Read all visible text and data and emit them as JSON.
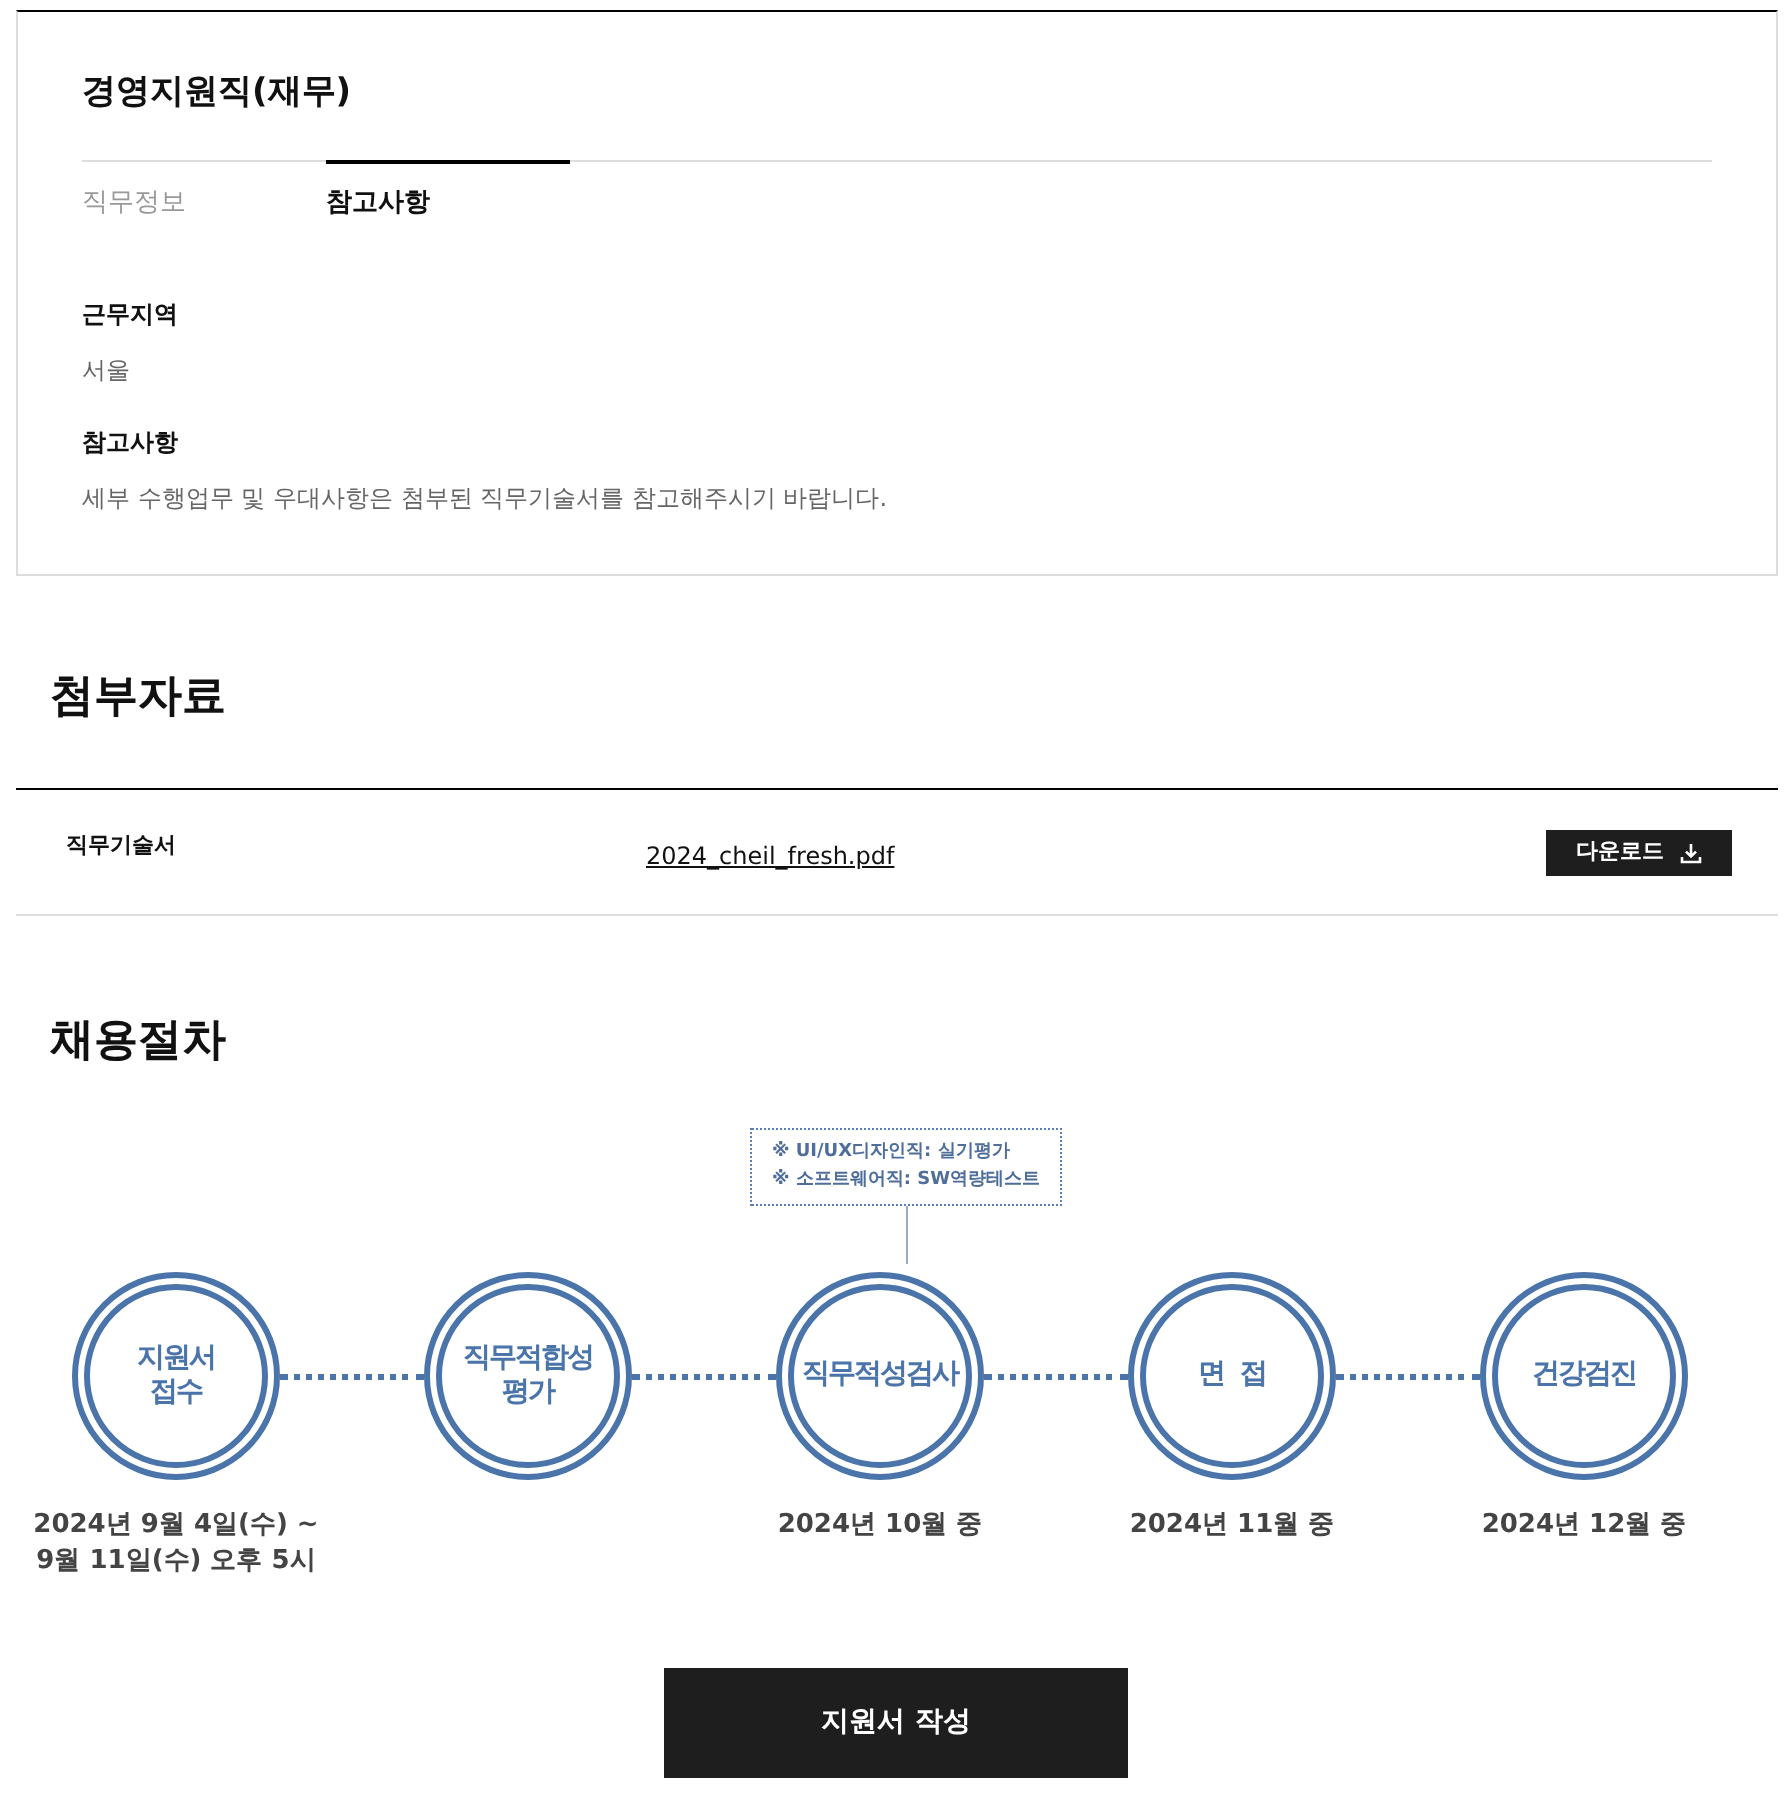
{
  "job": {
    "title": "경영지원직(재무)",
    "tabs": [
      {
        "label": "직무정보",
        "selected": false
      },
      {
        "label": "참고사항",
        "selected": true
      }
    ],
    "fields": [
      {
        "heading": "근무지역",
        "text": "서울"
      },
      {
        "heading": "참고사항",
        "text": "세부 수행업무 및 우대사항은 첨부된 직무기술서를 참고해주시기 바랍니다."
      }
    ]
  },
  "attachments": {
    "title": "첨부자료",
    "rows": [
      {
        "name": "직무기술서",
        "file": "2024_cheil_fresh.pdf",
        "button": "다운로드"
      }
    ]
  },
  "process": {
    "title": "채용절차",
    "steps": [
      {
        "label": [
          "지원서",
          "접수"
        ],
        "date": [
          "2024년 9월 4일(수) ~",
          "9월 11일(수) 오후 5시"
        ]
      },
      {
        "label": [
          "직무적합성",
          "평가"
        ]
      },
      {
        "label": [
          "직무적성검사"
        ],
        "date": [
          "2024년 10월 중"
        ],
        "note": [
          "※ UI/UX디자인직: 실기평가",
          "※ 소프트웨어직: SW역량테스트"
        ]
      },
      {
        "label": [
          "면  접"
        ],
        "date": [
          "2024년 11월 중"
        ]
      },
      {
        "label": [
          "건강검진"
        ],
        "date": [
          "2024년 12월 중"
        ]
      }
    ]
  },
  "apply_button": "지원서 작성"
}
